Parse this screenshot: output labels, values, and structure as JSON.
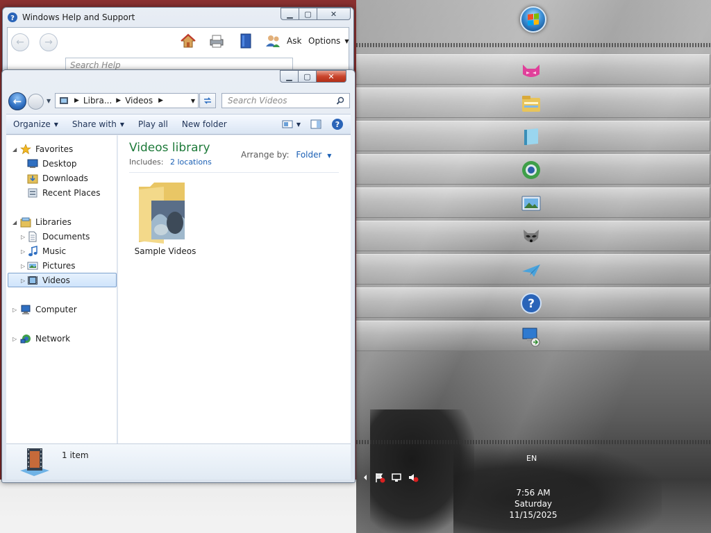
{
  "help_window": {
    "title": "Windows Help and Support",
    "search_placeholder": "Search Help",
    "ask_label": "Ask",
    "options_label": "Options"
  },
  "explorer": {
    "breadcrumb": [
      "Libra...",
      "Videos"
    ],
    "search_placeholder": "Search Videos",
    "toolbar": {
      "organize": "Organize",
      "share_with": "Share with",
      "play_all": "Play all",
      "new_folder": "New folder"
    },
    "nav": {
      "favorites": "Favorites",
      "desktop": "Desktop",
      "downloads": "Downloads",
      "recent_places": "Recent Places",
      "libraries": "Libraries",
      "documents": "Documents",
      "music": "Music",
      "pictures": "Pictures",
      "videos": "Videos",
      "computer": "Computer",
      "network": "Network"
    },
    "library": {
      "title": "Videos library",
      "includes_label": "Includes:",
      "includes_link": "2 locations",
      "arrange_label": "Arrange by:",
      "arrange_value": "Folder"
    },
    "items": [
      {
        "name": "Sample Videos"
      }
    ],
    "status": {
      "count": "1 item"
    }
  },
  "taskbar": {
    "language": "EN",
    "clock": {
      "time": "7:56 AM",
      "day": "Saturday",
      "date": "11/15/2025"
    },
    "buttons": [
      {
        "icon": "pink-cat-icon"
      },
      {
        "icon": "file-explorer-icon"
      },
      {
        "icon": "notebook-icon"
      },
      {
        "icon": "browser-globe-icon"
      },
      {
        "icon": "picture-viewer-icon"
      },
      {
        "icon": "raccoon-icon"
      },
      {
        "icon": "paper-plane-icon"
      },
      {
        "icon": "help-icon"
      },
      {
        "icon": "remote-desktop-icon"
      }
    ]
  },
  "colors": {
    "library_title": "#1e7a3a",
    "link": "#1a5fb4",
    "close_red": "#c9452d"
  }
}
